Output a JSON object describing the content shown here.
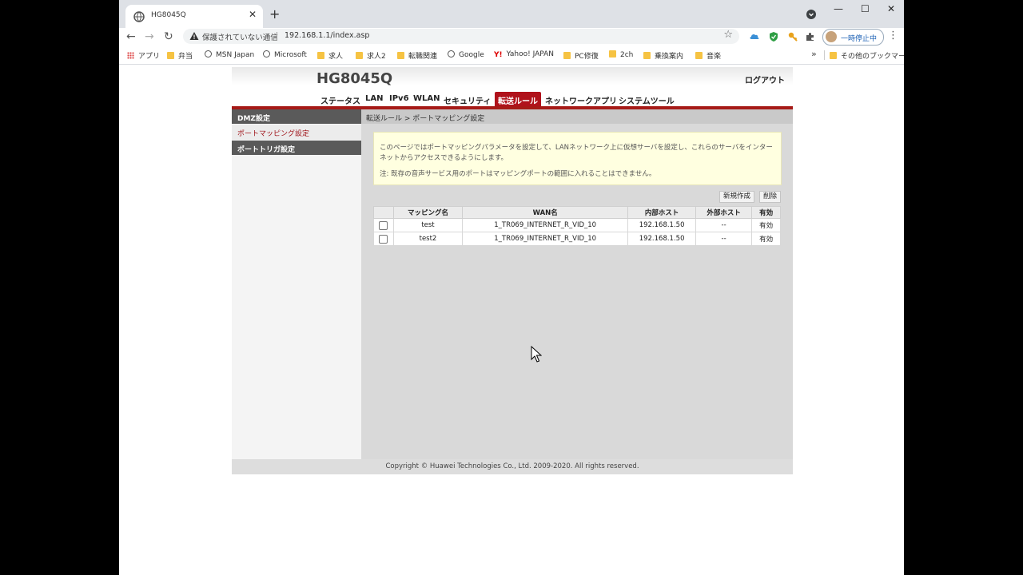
{
  "browser": {
    "tab_title": "HG8045Q",
    "tab_close": "✕",
    "new_tab": "+",
    "win_min": "—",
    "win_max": "☐",
    "win_close": "✕",
    "nav_back": "←",
    "nav_forward": "→",
    "nav_reload": "↻",
    "security_label": "保護されていない通信",
    "url": "192.168.1.1/index.asp",
    "bookmark_star": "☆",
    "profile_label": "一時停止中",
    "menu": "⋮",
    "icons": [
      "globe-icon",
      "warning-icon",
      "star-icon",
      "puzzle-icon",
      "shield-icon",
      "key-icon",
      "cloud-icon"
    ]
  },
  "bookmarks": {
    "items": [
      {
        "label": "アプリ",
        "icon": "apps"
      },
      {
        "label": "弁当",
        "icon": "folder"
      },
      {
        "label": "MSN Japan",
        "icon": "globe"
      },
      {
        "label": "Microsoft",
        "icon": "globe"
      },
      {
        "label": "求人",
        "icon": "folder"
      },
      {
        "label": "求人2",
        "icon": "folder"
      },
      {
        "label": "転職関連",
        "icon": "folder"
      },
      {
        "label": "Google",
        "icon": "globe"
      },
      {
        "label": "Yahoo! JAPAN",
        "icon": "yahoo"
      },
      {
        "label": "PC修復",
        "icon": "folder"
      },
      {
        "label": "2ch",
        "icon": "folder"
      },
      {
        "label": "乗換案内",
        "icon": "folder"
      },
      {
        "label": "音楽",
        "icon": "folder"
      }
    ],
    "more": "»",
    "other": "その他のブックマーク",
    "yahoo_mark": "Y!"
  },
  "router": {
    "model": "HG8045Q",
    "logout": "ログアウト",
    "nav": [
      "ステータス",
      "LAN",
      "IPv6",
      "WLAN",
      "セキュリティ",
      "転送ルール",
      "ネットワークアプリ",
      "システムツール"
    ],
    "nav_active_index": 5,
    "sidebar": {
      "items": [
        "DMZ設定",
        "ポートマッピング設定",
        "ポートトリガ設定"
      ]
    },
    "breadcrumb": "転送ルール > ポートマッピング設定",
    "notice": {
      "line1": "このページではポートマッピングパラメータを設定して、LANネットワーク上に仮想サーバを設定し、これらのサーバをインターネットからアクセスできるようにします。",
      "line2": "注: 既存の音声サービス用のポートはマッピングポートの範囲に入れることはできません。"
    },
    "buttons": {
      "create": "新規作成",
      "delete": "削除"
    },
    "table": {
      "headers": [
        "",
        "マッピング名",
        "WAN名",
        "内部ホスト",
        "外部ホスト",
        "有効"
      ],
      "rows": [
        {
          "name": "test",
          "wan": "1_TR069_INTERNET_R_VID_10",
          "internal": "192.168.1.50",
          "external": "--",
          "enabled": "有効"
        },
        {
          "name": "test2",
          "wan": "1_TR069_INTERNET_R_VID_10",
          "internal": "192.168.1.50",
          "external": "--",
          "enabled": "有効"
        }
      ]
    },
    "footer": "Copyright © Huawei Technologies Co., Ltd. 2009-2020. All rights reserved.",
    "colors": {
      "accent_red": "#b0121b",
      "sidebar_header": "#5a5a5a",
      "notice_bg": "#ffffe0"
    }
  }
}
